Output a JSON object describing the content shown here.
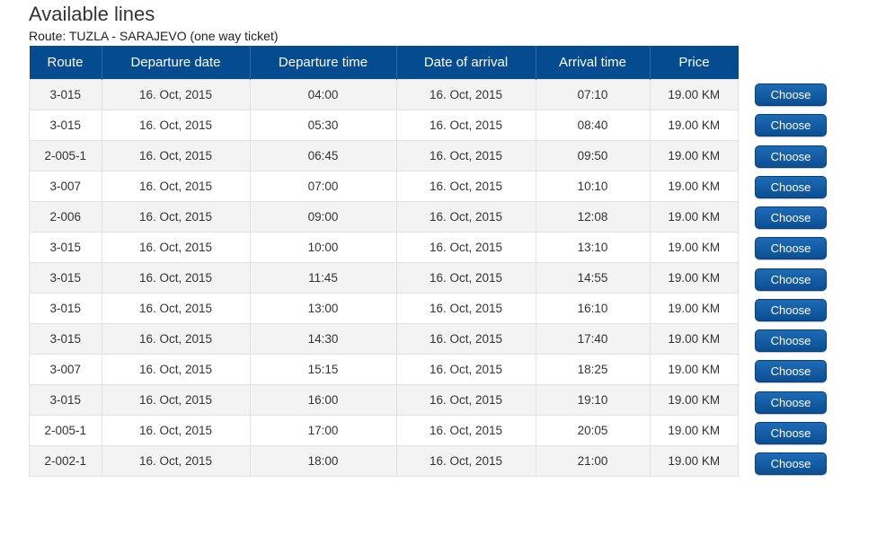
{
  "title": "Available lines",
  "route_info": "Route: TUZLA - SARAJEVO (one way ticket)",
  "table": {
    "headers": [
      "Route",
      "Departure date",
      "Departure time",
      "Date of arrival",
      "Arrival time",
      "Price"
    ],
    "rows": [
      [
        "3-015",
        "16. Oct, 2015",
        "04:00",
        "16. Oct, 2015",
        "07:10",
        "19.00 KM"
      ],
      [
        "3-015",
        "16. Oct, 2015",
        "05:30",
        "16. Oct, 2015",
        "08:40",
        "19.00 KM"
      ],
      [
        "2-005-1",
        "16. Oct, 2015",
        "06:45",
        "16. Oct, 2015",
        "09:50",
        "19.00 KM"
      ],
      [
        "3-007",
        "16. Oct, 2015",
        "07:00",
        "16. Oct, 2015",
        "10:10",
        "19.00 KM"
      ],
      [
        "2-006",
        "16. Oct, 2015",
        "09:00",
        "16. Oct, 2015",
        "12:08",
        "19.00 KM"
      ],
      [
        "3-015",
        "16. Oct, 2015",
        "10:00",
        "16. Oct, 2015",
        "13:10",
        "19.00 KM"
      ],
      [
        "3-015",
        "16. Oct, 2015",
        "11:45",
        "16. Oct, 2015",
        "14:55",
        "19.00 KM"
      ],
      [
        "3-015",
        "16. Oct, 2015",
        "13:00",
        "16. Oct, 2015",
        "16:10",
        "19.00 KM"
      ],
      [
        "3-015",
        "16. Oct, 2015",
        "14:30",
        "16. Oct, 2015",
        "17:40",
        "19.00 KM"
      ],
      [
        "3-007",
        "16. Oct, 2015",
        "15:15",
        "16. Oct, 2015",
        "18:25",
        "19.00 KM"
      ],
      [
        "3-015",
        "16. Oct, 2015",
        "16:00",
        "16. Oct, 2015",
        "19:10",
        "19.00 KM"
      ],
      [
        "2-005-1",
        "16. Oct, 2015",
        "17:00",
        "16. Oct, 2015",
        "20:05",
        "19.00 KM"
      ],
      [
        "2-002-1",
        "16. Oct, 2015",
        "18:00",
        "16. Oct, 2015",
        "21:00",
        "19.00 KM"
      ]
    ]
  },
  "choose_label": "Choose",
  "colors": {
    "header_bg": "#054b90",
    "button_bg": "#0b4f93",
    "row_alt_bg": "#f3f3f3"
  }
}
